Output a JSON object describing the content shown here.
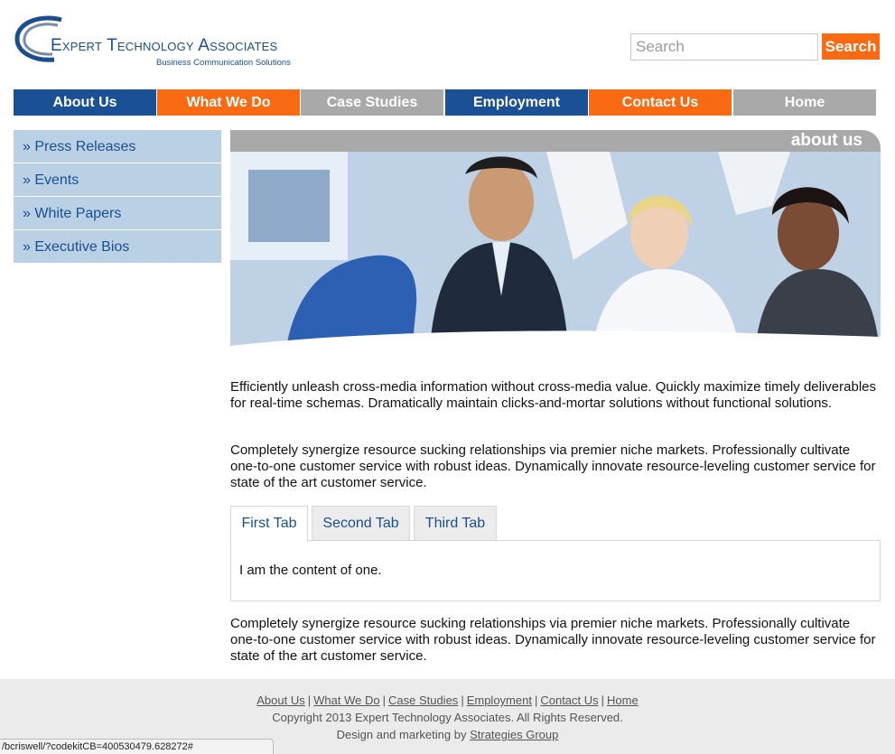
{
  "header": {
    "logo_title": "Expert Technology Associates",
    "logo_subtitle": "Business Communication Solutions",
    "search_placeholder": "Search",
    "search_button": "Search"
  },
  "nav": [
    {
      "label": "About Us",
      "color": "#1a5196"
    },
    {
      "label": "What We Do",
      "color": "#f96a12"
    },
    {
      "label": "Case Studies",
      "color": "#a9a9a9"
    },
    {
      "label": "Employment",
      "color": "#1a5196"
    },
    {
      "label": "Contact Us",
      "color": "#f96a12"
    },
    {
      "label": "Home",
      "color": "#a9a9a9"
    }
  ],
  "sidebar": {
    "items": [
      {
        "label": "» Press Releases"
      },
      {
        "label": "» Events"
      },
      {
        "label": "» White Papers"
      },
      {
        "label": "» Executive Bios"
      }
    ]
  },
  "main": {
    "section_title": "about us",
    "paragraph1": "Efficiently unleash cross-media information without cross-media value. Quickly maximize timely deliverables for real-time schemas. Dramatically maintain clicks-and-mortar solutions without functional solutions.",
    "paragraph2": "Completely synergize resource sucking relationships via premier niche markets. Professionally cultivate one-to-one customer service with robust ideas. Dynamically innovate resource-leveling customer service for state of the art customer service.",
    "tabs": [
      {
        "label": "First Tab",
        "active": true
      },
      {
        "label": "Second Tab",
        "active": false
      },
      {
        "label": "Third Tab",
        "active": false
      }
    ],
    "tab_content": "I am the content of one.",
    "paragraph3": "Completely synergize resource sucking relationships via premier niche markets. Professionally cultivate one-to-one customer service with robust ideas. Dynamically innovate resource-leveling customer service for state of the art customer service."
  },
  "footer": {
    "links": [
      "About Us",
      "What We Do",
      "Case Studies",
      "Employment",
      "Contact Us",
      "Home"
    ],
    "copyright": "Copyright 2013 Expert Technology Associates. All Rights Reserved.",
    "design_prefix": "Design and marketing by",
    "design_link": "Strategies Group"
  },
  "status_bar": {
    "url": "/bcriswell/?codekitCB=400530479.628272#"
  },
  "colors": {
    "brand_blue": "#1a5196",
    "brand_orange": "#f96a12",
    "nav_gray": "#a9a9a9",
    "sidebar_bg": "#b9d0e5"
  }
}
